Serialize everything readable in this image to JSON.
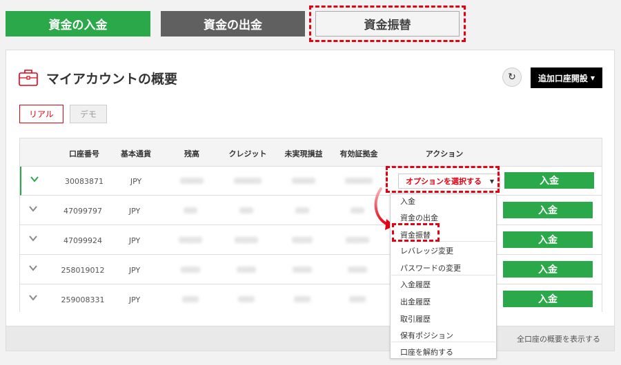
{
  "top_buttons": {
    "deposit": "資金の入金",
    "withdraw": "資金の出金",
    "transfer": "資金振替"
  },
  "header": {
    "title": "マイアカウントの概要",
    "add_account": "追加口座開設",
    "briefcase_icon": "briefcase-icon",
    "refresh_icon": "refresh-icon"
  },
  "tabs": {
    "real": "リアル",
    "demo": "デモ"
  },
  "table": {
    "columns": [
      "口座番号",
      "基本通貨",
      "残高",
      "クレジット",
      "未実現損益",
      "有効証拠金",
      "アクション"
    ],
    "rows": [
      {
        "account": "30083871",
        "currency": "JPY",
        "deposit": "入金"
      },
      {
        "account": "47099797",
        "currency": "JPY",
        "deposit": "入金"
      },
      {
        "account": "47099924",
        "currency": "JPY",
        "deposit": "入金"
      },
      {
        "account": "258019012",
        "currency": "JPY",
        "deposit": "入金"
      },
      {
        "account": "259008331",
        "currency": "JPY",
        "deposit": "入金"
      }
    ],
    "option_select": "オプションを選択する"
  },
  "menu": {
    "items": [
      "入金",
      "資金の出金",
      "資金振替",
      "レバレッジ変更",
      "パスワードの変更",
      "入金履歴",
      "出金履歴",
      "取引履歴",
      "保有ポジション",
      "口座を解約する"
    ]
  },
  "footer": {
    "link": "全口座の概要を表示する"
  },
  "colors": {
    "green": "#2aa84a",
    "dark_gray": "#606060",
    "highlight_red": "#e60012"
  }
}
